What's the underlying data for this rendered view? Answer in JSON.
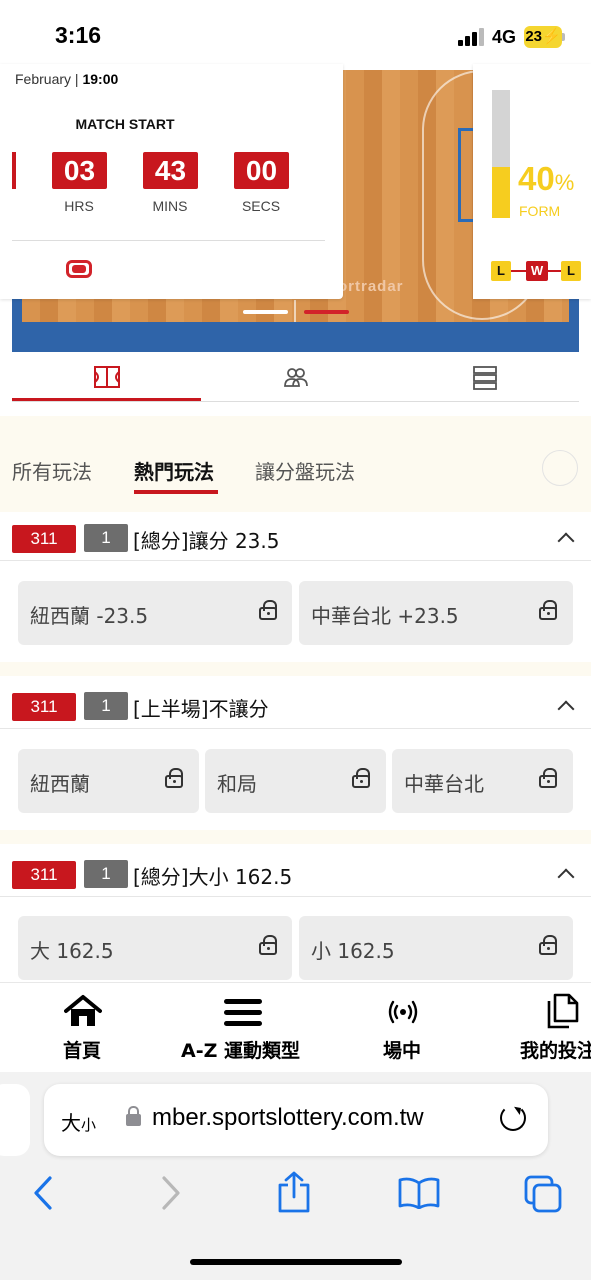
{
  "status": {
    "time": "3:16",
    "network": "4G",
    "battery": "23"
  },
  "match": {
    "date_month": "February",
    "date_time": "19:00",
    "start_label": "MATCH START",
    "countdown": [
      {
        "value": "03",
        "unit": "HRS"
      },
      {
        "value": "43",
        "unit": "MINS"
      },
      {
        "value": "00",
        "unit": "SECS"
      }
    ],
    "court_brand": "ortradar",
    "form": {
      "percent": "40",
      "percent_sign": "%",
      "label": "FORM",
      "fill_fraction": 0.4,
      "results": [
        "L",
        "W",
        "L"
      ]
    }
  },
  "detail_tabs": [
    "court-icon",
    "players-icon",
    "table-icon"
  ],
  "market_tabs": [
    {
      "label": "所有玩法",
      "active": false
    },
    {
      "label": "熱門玩法",
      "active": true
    },
    {
      "label": "讓分盤玩法",
      "active": false
    }
  ],
  "markets": [
    {
      "code": "311",
      "num": "1",
      "title": "[總分]讓分 23.5",
      "options": [
        "紐西蘭 -23.5",
        "中華台北 +23.5"
      ]
    },
    {
      "code": "311",
      "num": "1",
      "title": "[上半場]不讓分",
      "options": [
        "紐西蘭",
        "和局",
        "中華台北"
      ]
    },
    {
      "code": "311",
      "num": "1",
      "title": "[總分]大小 162.5",
      "options": [
        "大 162.5",
        "小 162.5"
      ]
    }
  ],
  "bottom_nav": [
    {
      "label": "首頁",
      "icon": "home-icon"
    },
    {
      "label": "A-Z 運動類型",
      "icon": "menu-icon"
    },
    {
      "label": "場中",
      "icon": "live-icon"
    },
    {
      "label": "我的投注",
      "icon": "bets-icon"
    }
  ],
  "browser": {
    "aa_big": "大",
    "aa_small": "小",
    "url": "mber.sportslottery.com.tw",
    "toolbar": [
      "back-icon",
      "forward-icon",
      "share-icon",
      "bookmarks-icon",
      "tabs-icon"
    ]
  },
  "colors": {
    "accent": "#c8171e",
    "form": "#f6cd1f",
    "court": "#2f64a9"
  }
}
